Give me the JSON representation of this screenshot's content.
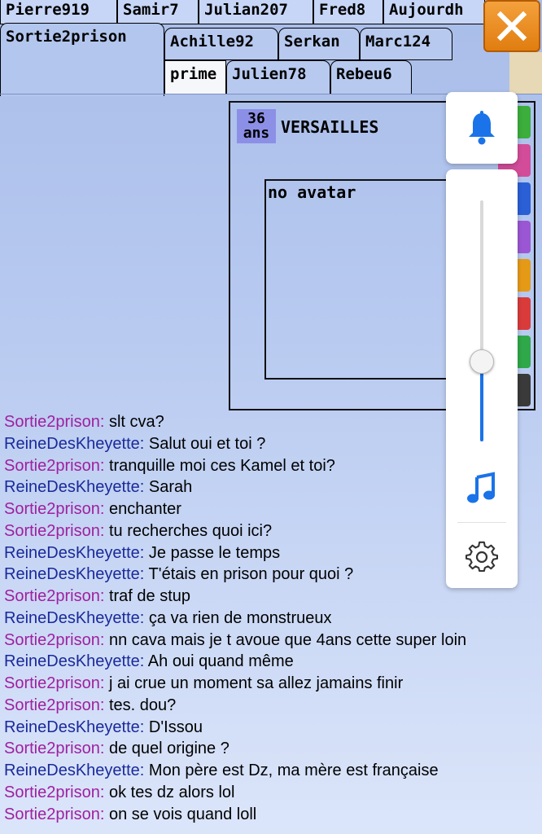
{
  "tabs_row1": [
    "Pierre919",
    "Samir7",
    "Julian207",
    "Fred8",
    "Aujourdh"
  ],
  "tabs_row2": [
    "Sortie2prison",
    "Achille92",
    "Serkan",
    "Marc124"
  ],
  "tabs_row3": [
    "prime",
    "Julien78",
    "Rebeu6"
  ],
  "profile": {
    "age": "36",
    "age_unit": "ans",
    "city": "VERSAILLES",
    "avatar_text": "no avatar"
  },
  "volume": {
    "level": 0.33
  },
  "icons": {
    "close": "close-icon",
    "bell": "bell-icon",
    "music": "music-note-icon",
    "settings": "gear-icon"
  },
  "colors": {
    "user_a": "#a020a0",
    "user_b": "#1a2a9a",
    "accent": "#1a73e8",
    "close_orange": "#e88a1a"
  },
  "chat": [
    {
      "user": "Sortie2prison",
      "text": "slt cva?"
    },
    {
      "user": "ReineDesKheyette",
      "text": "Salut oui et toi ?"
    },
    {
      "user": "Sortie2prison",
      "text": "tranquille moi ces Kamel et toi?"
    },
    {
      "user": "ReineDesKheyette",
      "text": "Sarah"
    },
    {
      "user": "Sortie2prison",
      "text": "enchanter"
    },
    {
      "user": "Sortie2prison",
      "text": "tu recherches quoi ici?"
    },
    {
      "user": "ReineDesKheyette",
      "text": "Je passe le temps"
    },
    {
      "user": "ReineDesKheyette",
      "text": "T'étais en prison pour quoi ?"
    },
    {
      "user": "Sortie2prison",
      "text": "traf de stup"
    },
    {
      "user": "ReineDesKheyette",
      "text": "ça va rien de monstrueux"
    },
    {
      "user": "Sortie2prison",
      "text": "nn cava mais je t avoue que 4ans cette super loin"
    },
    {
      "user": "ReineDesKheyette",
      "text": "Ah oui quand même"
    },
    {
      "user": "Sortie2prison",
      "text": "j ai crue un moment sa allez jamains finir"
    },
    {
      "user": "Sortie2prison",
      "text": "tes. dou?"
    },
    {
      "user": "ReineDesKheyette",
      "text": "D'Issou"
    },
    {
      "user": "Sortie2prison",
      "text": "de quel origine ?"
    },
    {
      "user": "ReineDesKheyette",
      "text": "Mon père est Dz, ma mère est française"
    },
    {
      "user": "Sortie2prison",
      "text": "ok tes dz alors lol"
    },
    {
      "user": "Sortie2prison",
      "text": "on se vois quand loll"
    }
  ]
}
